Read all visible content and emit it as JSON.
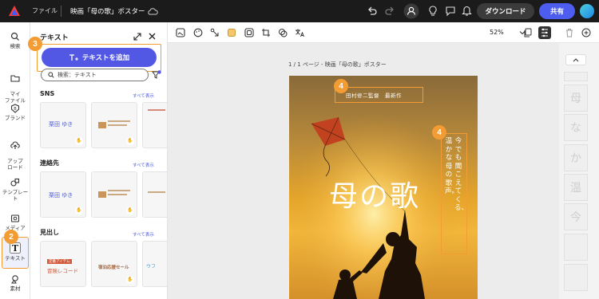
{
  "topbar": {
    "file_menu": "ファイル",
    "doc_title": "映画「母の歌」ポスター",
    "download_label": "ダウンロード",
    "share_label": "共有"
  },
  "rail": {
    "items": [
      {
        "label": "検索",
        "icon": "search-icon"
      },
      {
        "label": "マイ\nファイル",
        "icon": "folder-icon"
      },
      {
        "label": "ブランド",
        "icon": "brand-icon"
      },
      {
        "label": "アップ\nロード",
        "icon": "upload-icon"
      },
      {
        "label": "テンプレート",
        "icon": "template-icon"
      },
      {
        "label": "メディア",
        "icon": "media-icon"
      },
      {
        "label": "テキスト",
        "icon": "text-icon"
      },
      {
        "label": "素材",
        "icon": "elements-icon"
      }
    ]
  },
  "panel": {
    "title": "テキスト",
    "add_text_label": "テキストを追加",
    "search_placeholder": "検索：テキスト",
    "sections": [
      {
        "title": "SNS",
        "see_all": "すべて表示"
      },
      {
        "title": "連絡先",
        "see_all": "すべて表示"
      },
      {
        "title": "見出し",
        "see_all": "すべて表示"
      }
    ],
    "cards": {
      "sns_1": "栗田 ゆき",
      "contact_1": "栗田 ゆき",
      "heading_1_top": "定番アイテム",
      "heading_1": "冒険レコード",
      "heading_2": "宿泊応援セール",
      "heading_3": "ウフ"
    }
  },
  "badges": {
    "text_rail": "2",
    "add_text": "3",
    "director": "4",
    "vertical": "4"
  },
  "toolbar": {
    "zoom": "52%"
  },
  "canvas": {
    "page_label": "1 / 1 ページ - 映画「母の歌」ポスター",
    "director_line": "田村修二監督　最新作",
    "main_title": "母の歌",
    "vertical_columns": [
      "今でも聞こえてくる、",
      "温かな母の歌声。"
    ]
  },
  "thumbnails": [
    "母",
    "な",
    "か",
    "温",
    "今",
    "",
    ""
  ],
  "colors": {
    "accent": "#4c5df0",
    "highlight": "#f39c33",
    "topbar": "#1b1b1b"
  }
}
